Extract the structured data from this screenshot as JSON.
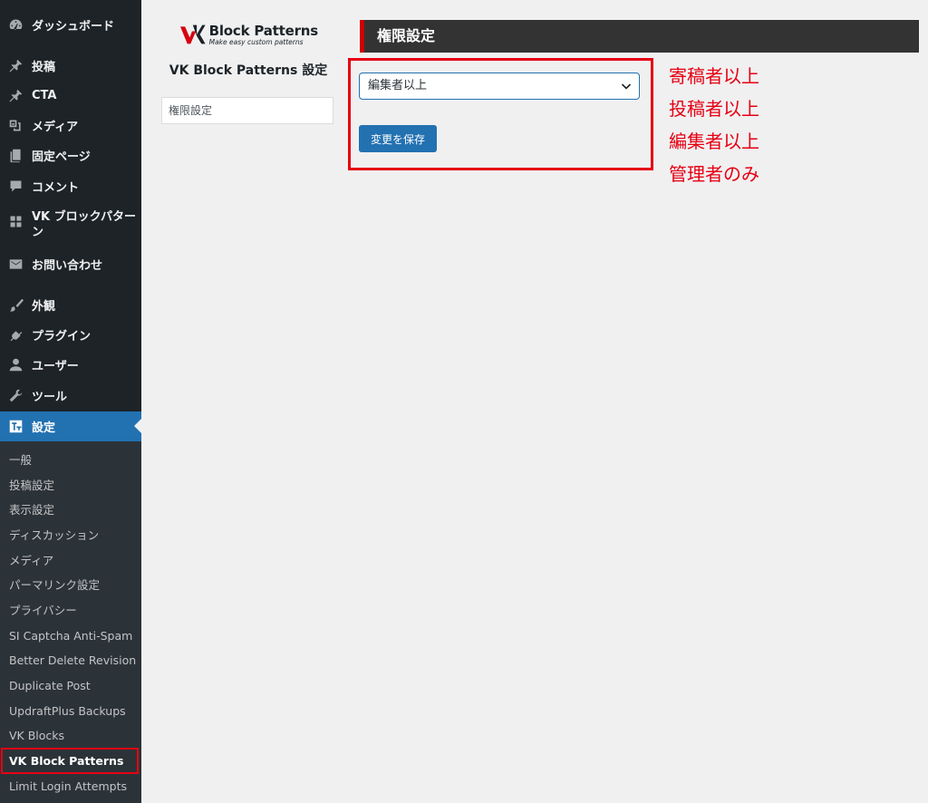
{
  "sidebar": {
    "menu": [
      {
        "label": "ダッシュボード",
        "icon": "dashboard-icon"
      },
      {
        "label": "投稿",
        "icon": "pin-icon"
      },
      {
        "label": "CTA",
        "icon": "pin-icon"
      },
      {
        "label": "メディア",
        "icon": "media-icon"
      },
      {
        "label": "固定ページ",
        "icon": "page-icon"
      },
      {
        "label": "コメント",
        "icon": "comment-icon"
      },
      {
        "label": "VK ブロックパターン",
        "icon": "grid-icon"
      },
      {
        "label": "お問い合わせ",
        "icon": "mail-icon"
      },
      {
        "label": "外観",
        "icon": "brush-icon"
      },
      {
        "label": "プラグイン",
        "icon": "plugin-icon"
      },
      {
        "label": "ユーザー",
        "icon": "user-icon"
      },
      {
        "label": "ツール",
        "icon": "wrench-icon"
      },
      {
        "label": "設定",
        "icon": "settings-icon"
      }
    ],
    "submenu": [
      "一般",
      "投稿設定",
      "表示設定",
      "ディスカッション",
      "メディア",
      "パーマリンク設定",
      "プライバシー",
      "SI Captcha Anti-Spam",
      "Better Delete Revision",
      "Duplicate Post",
      "UpdraftPlus Backups",
      "VK Blocks",
      "VK Block Patterns",
      "Limit Login Attempts"
    ]
  },
  "logo": {
    "name": "Block Patterns",
    "tagline": "Make easy custom patterns"
  },
  "plugin_title": "VK Block Patterns 設定",
  "side_nav": {
    "item": "権限設定"
  },
  "section": {
    "title": "権限設定"
  },
  "form": {
    "role_select_value": "編集者以上",
    "save_label": "変更を保存"
  },
  "annotation": {
    "options": [
      "寄稿者以上",
      "投稿者以上",
      "編集者以上",
      "管理者のみ"
    ]
  },
  "colors": {
    "accent": "#2271b1",
    "highlight": "#e60012",
    "sidebar": "#1d2327"
  }
}
